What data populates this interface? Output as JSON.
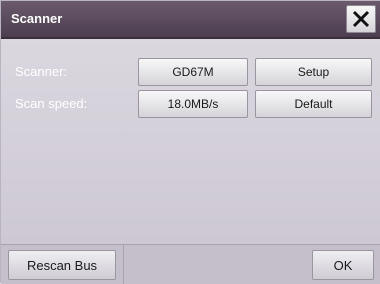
{
  "window": {
    "title": "Scanner",
    "close_icon": "close-icon"
  },
  "settings": {
    "scanner_label": "Scanner:",
    "scanner_value": "GD67M",
    "setup_label": "Setup",
    "scan_speed_label": "Scan speed:",
    "scan_speed_value": "18.0MB/s",
    "default_label": "Default"
  },
  "footer": {
    "rescan_label": "Rescan Bus",
    "ok_label": "OK"
  }
}
